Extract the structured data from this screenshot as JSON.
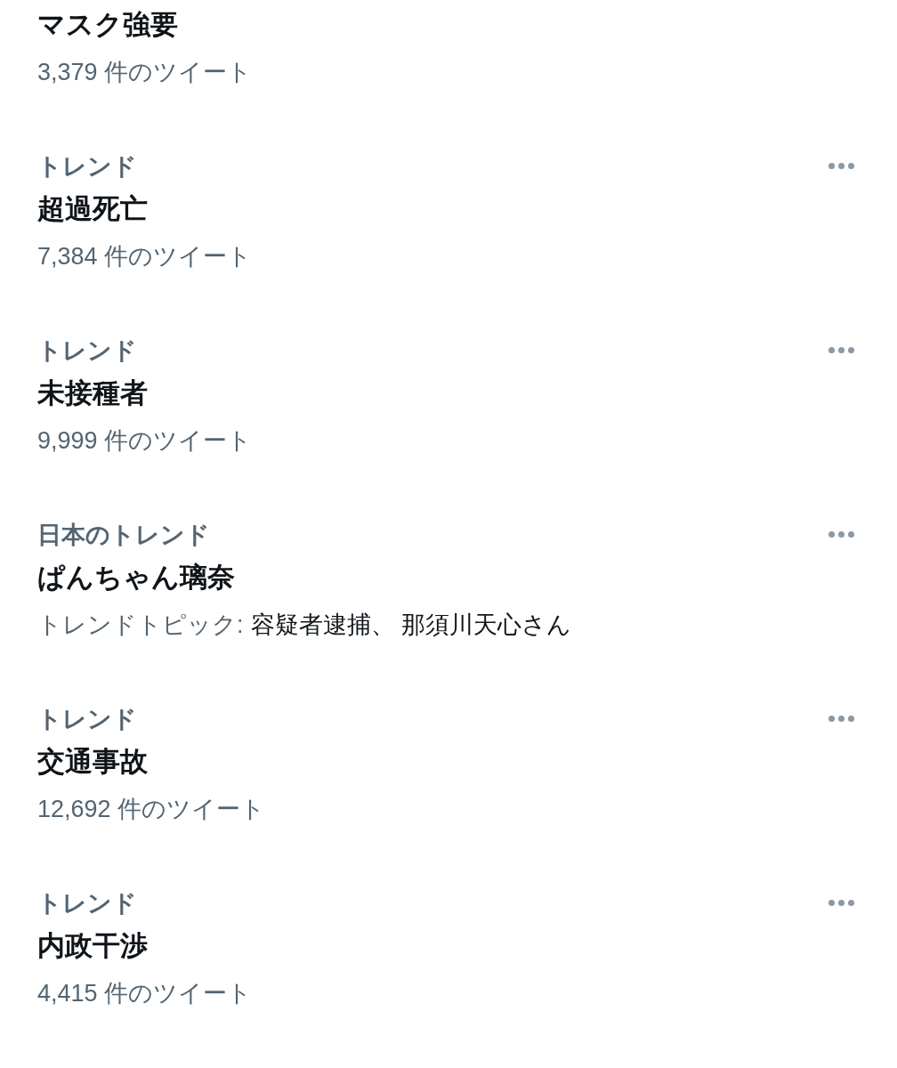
{
  "trends": [
    {
      "title": "マスク強要",
      "count": "3,379 件のツイート",
      "more_button": false
    },
    {
      "category": "トレンド",
      "title": "超過死亡",
      "count": "7,384 件のツイート",
      "more_button": true
    },
    {
      "category": "トレンド",
      "title": "未接種者",
      "count": "9,999 件のツイート",
      "more_button": true
    },
    {
      "category": "日本のトレンド",
      "title": "ぱんちゃん璃奈",
      "topic_label": "トレンドトピック:",
      "topics": "容疑者逮捕、 那須川天心さん",
      "more_button": true
    },
    {
      "category": "トレンド",
      "title": "交通事故",
      "count": "12,692 件のツイート",
      "more_button": true
    },
    {
      "category": "トレンド",
      "title": "内政干渉",
      "count": "4,415 件のツイート",
      "more_button": true
    }
  ]
}
